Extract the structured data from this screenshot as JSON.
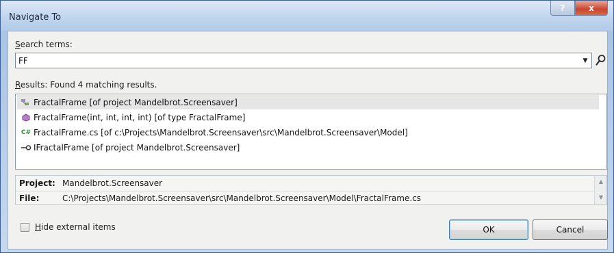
{
  "window": {
    "title": "Navigate To",
    "help_button": "?",
    "close_button": "x"
  },
  "search": {
    "label_underlined": "S",
    "label_rest": "earch terms:",
    "value": "FF",
    "placeholder": ""
  },
  "results": {
    "label_underlined": "R",
    "label_rest": "esults: Found 4 matching results.",
    "items": [
      {
        "icon": "class-icon",
        "text": "FractalFrame [of project Mandelbrot.Screensaver]",
        "selected": true
      },
      {
        "icon": "method-icon",
        "text": "FractalFrame(int, int, int, int) [of type FractalFrame]",
        "selected": false
      },
      {
        "icon": "csharp-file-icon",
        "text": "FractalFrame.cs [of c:\\Projects\\Mandelbrot.Screensaver\\src\\Mandelbrot.Screensaver\\Model]",
        "selected": false
      },
      {
        "icon": "interface-icon",
        "text": "IFractalFrame [of project Mandelbrot.Screensaver]",
        "selected": false
      }
    ]
  },
  "details": {
    "project_label": "Project:",
    "project_value": "Mandelbrot.Screensaver",
    "file_label": "File:",
    "file_value": "C:\\Projects\\Mandelbrot.Screensaver\\src\\Mandelbrot.Screensaver\\Model\\FractalFrame.cs"
  },
  "options": {
    "hide_external_underlined": "H",
    "hide_external_rest": "ide external items",
    "hide_external_checked": false
  },
  "buttons": {
    "ok": "OK",
    "cancel": "Cancel"
  },
  "colors": {
    "title_bar": "#c3d7ee",
    "selection": "#e6e6e6",
    "close_button": "#c8452f"
  }
}
